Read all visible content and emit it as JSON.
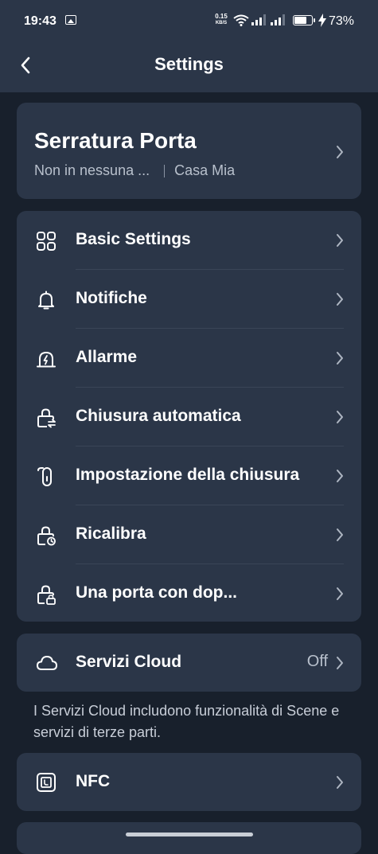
{
  "status_bar": {
    "time": "19:43",
    "net_speed_value": "0.15",
    "net_speed_unit": "KB/S",
    "battery_level": 0.73,
    "battery_percent": "73%",
    "icons": [
      "image-notification-icon",
      "wifi-icon",
      "signal-icon",
      "signal-icon",
      "battery-icon",
      "charging-bolt-icon"
    ]
  },
  "header": {
    "title": "Settings",
    "back_icon": "back-arrow-icon"
  },
  "device": {
    "name": "Serratura Porta",
    "room": "Non in nessuna ...",
    "home": "Casa  Mia"
  },
  "menu": {
    "items": [
      {
        "label": "Basic Settings",
        "icon": "grid-icon"
      },
      {
        "label": "Notifiche",
        "icon": "bell-icon"
      },
      {
        "label": "Allarme",
        "icon": "alarm-icon"
      },
      {
        "label": "Chiusura  automatica",
        "icon": "auto-lock-icon"
      },
      {
        "label": "Impostazione della chiusura",
        "icon": "door-handle-icon"
      },
      {
        "label": "Ricalibra",
        "icon": "recalibrate-lock-icon"
      },
      {
        "label": "Una porta con dop...",
        "icon": "double-lock-icon"
      }
    ]
  },
  "cloud": {
    "label": "Servizi  Cloud",
    "value": "Off",
    "icon": "cloud-icon",
    "note": "I  Servizi Cloud includono funzionalità di Scene e servizi di terze parti."
  },
  "nfc": {
    "label": "NFC",
    "icon": "nfc-icon"
  },
  "colors": {
    "background": "#18202c",
    "card": "#2b3648",
    "divider": "#3a4557",
    "secondary_text": "#b8c0cc"
  }
}
